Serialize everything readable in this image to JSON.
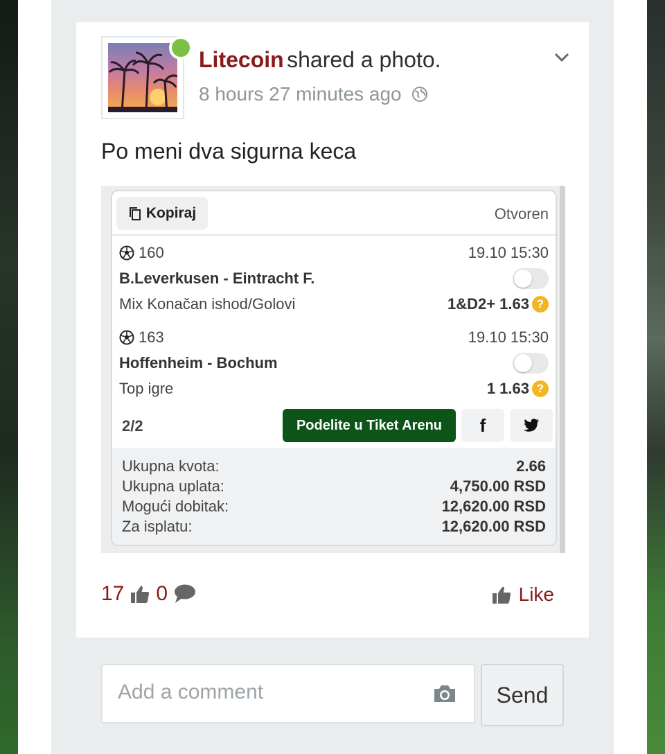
{
  "post": {
    "author": "Litecoin",
    "action": "shared a photo.",
    "timestamp": "8 hours 27 minutes ago",
    "text": "Po meni dva sigurna keca"
  },
  "ticket": {
    "copy_label": "Kopiraj",
    "status": "Otvoren",
    "matches": [
      {
        "number": "160",
        "datetime": "19.10 15:30",
        "teams": "B.Leverkusen - Eintracht F.",
        "market": "Mix Konačan ishod/Golovi",
        "odds": "1&D2+ 1.63"
      },
      {
        "number": "163",
        "datetime": "19.10 15:30",
        "teams": "Hoffenheim - Bochum",
        "market": "Top igre",
        "odds": "1 1.63"
      }
    ],
    "count": "2/2",
    "share_button": "Podelite u Tiket Arenu",
    "facebook": "f",
    "totals": [
      {
        "label": "Ukupna kvota:",
        "value": "2.66"
      },
      {
        "label": "Ukupna uplata:",
        "value": "4,750.00 RSD"
      },
      {
        "label": "Mogući dobitak:",
        "value": "12,620.00 RSD"
      },
      {
        "label": "Za isplatu:",
        "value": "12,620.00 RSD"
      }
    ]
  },
  "stats": {
    "likes": "17",
    "comments": "0"
  },
  "like_label": "Like",
  "comment": {
    "placeholder": "Add a comment",
    "send_label": "Send"
  },
  "colors": {
    "accent": "#8b1a1a",
    "online": "#7ac143",
    "arena_button": "#0c5418",
    "question": "#f2b622"
  },
  "icons": [
    "chevron-down-icon",
    "globe-icon",
    "copy-icon",
    "soccer-ball-icon",
    "question-icon",
    "twitter-icon",
    "thumbs-up-icon",
    "comment-icon",
    "camera-icon"
  ]
}
